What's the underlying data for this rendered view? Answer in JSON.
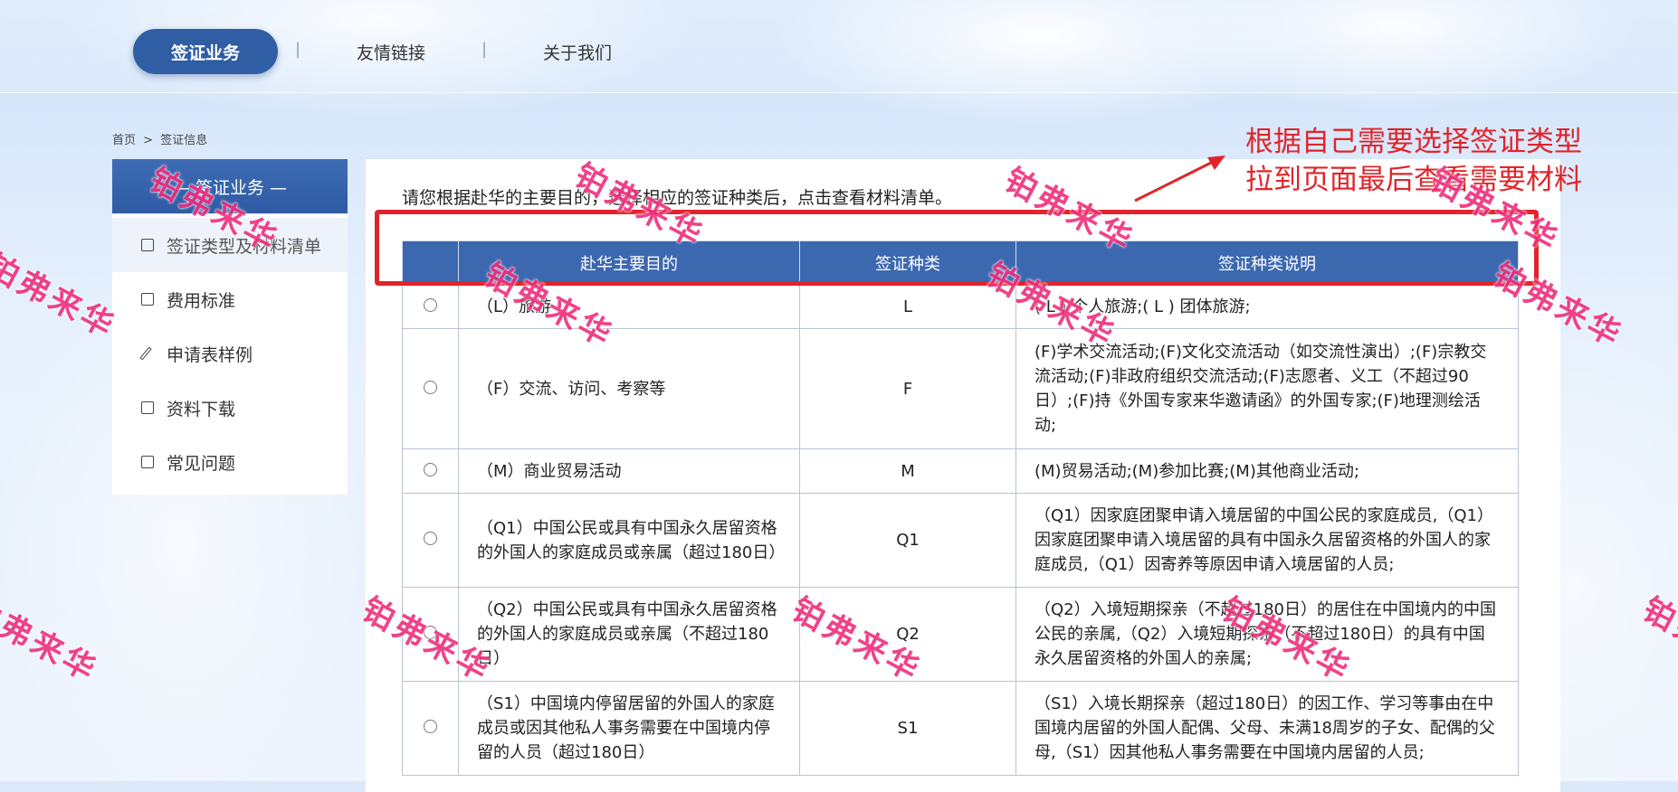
{
  "nav": {
    "active_label": "签证业务",
    "sep": "|",
    "links": [
      "友情链接",
      "关于我们"
    ]
  },
  "breadcrumb": {
    "home": "首页",
    "sep": ">",
    "current": "签证信息"
  },
  "sidebar": {
    "title": "— 签证业务 —",
    "items": [
      {
        "label": "签证类型及材料清单",
        "icon": "list-icon"
      },
      {
        "label": "费用标准",
        "icon": "yen-icon"
      },
      {
        "label": "申请表样例",
        "icon": "pen-icon"
      },
      {
        "label": "资料下载",
        "icon": "document-icon"
      },
      {
        "label": "常见问题",
        "icon": "question-icon"
      }
    ]
  },
  "main": {
    "intro": "请您根据赴华的主要目的，选择相应的签证种类后，点击查看材料清单。",
    "table": {
      "headers": [
        "",
        "赴华主要目的",
        "签证种类",
        "签证种类说明"
      ],
      "rows": [
        {
          "purpose": "（L）旅游",
          "code": "L",
          "desc": "( L ) 个人旅游;( L ) 团体旅游;"
        },
        {
          "purpose": "（F）交流、访问、考察等",
          "code": "F",
          "desc": "(F)学术交流活动;(F)文化交流活动（如交流性演出）;(F)宗教交流活动;(F)非政府组织交流活动;(F)志愿者、义工（不超过90日）;(F)持《外国专家来华邀请函》的外国专家;(F)地理测绘活动;"
        },
        {
          "purpose": "（M）商业贸易活动",
          "code": "M",
          "desc": "(M)贸易活动;(M)参加比赛;(M)其他商业活动;"
        },
        {
          "purpose": "（Q1）中国公民或具有中国永久居留资格的外国人的家庭成员或亲属（超过180日）",
          "code": "Q1",
          "desc": "（Q1）因家庭团聚申请入境居留的中国公民的家庭成员,（Q1）因家庭团聚申请入境居留的具有中国永久居留资格的外国人的家庭成员,（Q1）因寄养等原因申请入境居留的人员;"
        },
        {
          "purpose": "（Q2）中国公民或具有中国永久居留资格的外国人的家庭成员或亲属（不超过180日）",
          "code": "Q2",
          "desc": "（Q2）入境短期探亲（不超过180日）的居住在中国境内的中国公民的亲属,（Q2）入境短期探亲（不超过180日）的具有中国永久居留资格的外国人的亲属;"
        },
        {
          "purpose": "（S1）中国境内停留居留的外国人的家庭成员或因其他私人事务需要在中国境内停留的人员（超过180日）",
          "code": "S1",
          "desc": "（S1）入境长期探亲（超过180日）的因工作、学习等事由在中国境内居留的外国人配偶、父母、未满18周岁的子女、配偶的父母,（S1）因其他私人事务需要在中国境内居留的人员;"
        }
      ]
    }
  },
  "annotation": {
    "line1": "根据自己需要选择签证类型",
    "line2": "拉到页面最后查看需要材料",
    "color": "#e0242a"
  },
  "watermark": {
    "text": "铂弗来华",
    "color": "#ef2e7c"
  },
  "colors": {
    "primary": "#2f5ea5",
    "table_header": "#3c68b0"
  }
}
